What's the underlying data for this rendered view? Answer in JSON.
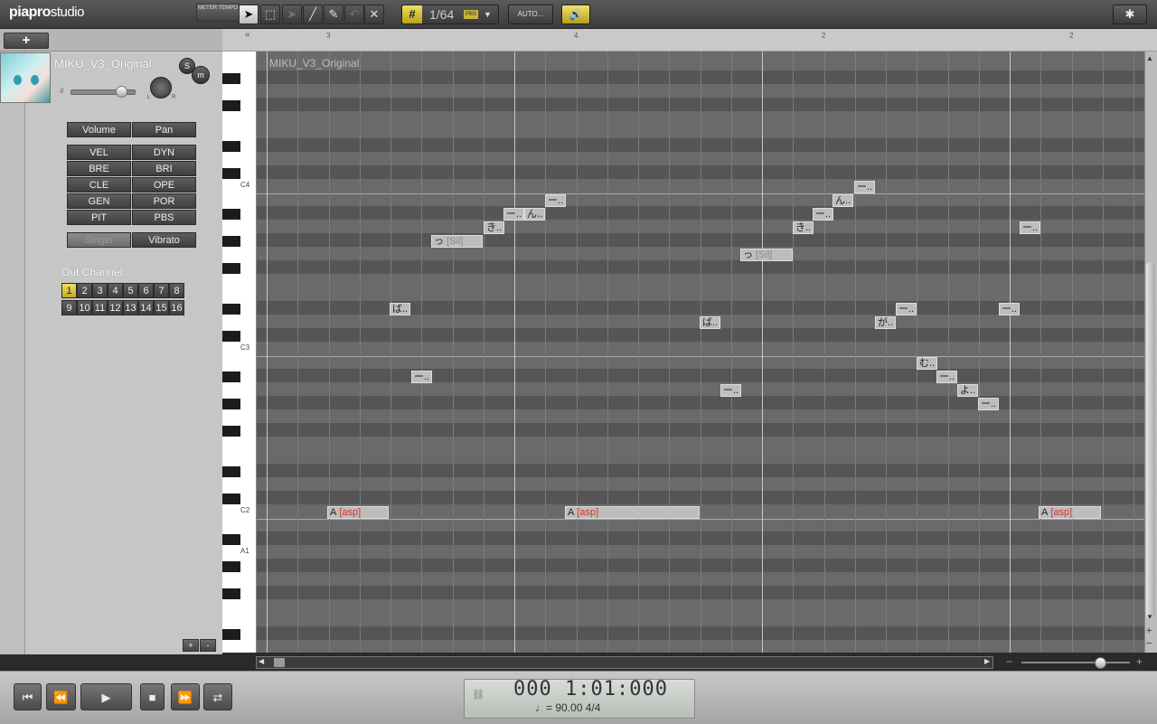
{
  "app": {
    "logo_main": "piapro",
    "logo_sub": "studio"
  },
  "toolbar": {
    "tools": [
      {
        "name": "arrow-tool",
        "glyph": "➤",
        "selected": true
      },
      {
        "name": "select-range-tool",
        "glyph": "⬚",
        "selected": false
      },
      {
        "name": "disabled-arrow-tool",
        "glyph": "➤",
        "selected": false
      },
      {
        "name": "pencil-line-tool",
        "glyph": "╱",
        "selected": false
      },
      {
        "name": "pencil-tool",
        "glyph": "✎",
        "selected": false
      },
      {
        "name": "disabled-tool",
        "glyph": "↶",
        "selected": false
      },
      {
        "name": "eraser-tool",
        "glyph": "✕",
        "selected": false
      }
    ],
    "grid_value": "1/64",
    "grid_tag": "PBS",
    "auto_label": "AUTO...",
    "speaker_glyph": "🔊",
    "settings_glyph": "✱"
  },
  "panel": {
    "add_label": "+",
    "meter_tempo": "METER TEMPO",
    "singer_name": "MIKU_V3_Original",
    "solo": "S",
    "mute": "m",
    "pan_l": "L",
    "pan_r": "R",
    "vol_icon": "ıl",
    "volume": 0.8,
    "param_rows": [
      [
        "Volume",
        "Pan"
      ],
      [
        "VEL",
        "DYN"
      ],
      [
        "BRE",
        "BRI"
      ],
      [
        "CLE",
        "OPE"
      ],
      [
        "GEN",
        "POR"
      ],
      [
        "PIT",
        "PBS"
      ],
      [
        "Singer",
        "Vibrato"
      ]
    ],
    "out_channel_label": "Out Channel:",
    "channels": [
      "1",
      "2",
      "3",
      "4",
      "5",
      "6",
      "7",
      "8",
      "9",
      "10",
      "11",
      "12",
      "13",
      "14",
      "15",
      "16"
    ],
    "selected_channel": "1",
    "plus": "+",
    "minus": "-"
  },
  "ruler": {
    "collapse": "«",
    "ticks": [
      "3",
      "4",
      "2",
      "2"
    ]
  },
  "keyboard": {
    "labels": [
      "C4",
      "C3",
      "C2",
      "A1"
    ]
  },
  "roll": {
    "track_label": "MIKU_V3_Original",
    "notes": [
      {
        "lyric": "っ",
        "phoneme": "[Sil]",
        "type": "sil"
      },
      {
        "lyric": "き..",
        "phoneme": "",
        "type": "n"
      },
      {
        "lyric": "ー..",
        "phoneme": "",
        "type": "n"
      },
      {
        "lyric": "ん..",
        "phoneme": "",
        "type": "n"
      },
      {
        "lyric": "ー..",
        "phoneme": "",
        "type": "n"
      },
      {
        "lyric": "ば..",
        "phoneme": "",
        "type": "n"
      },
      {
        "lyric": "ー..",
        "phoneme": "",
        "type": "n"
      },
      {
        "lyric": "っ",
        "phoneme": "[Sil]",
        "type": "sil"
      },
      {
        "lyric": "ば..",
        "phoneme": "",
        "type": "n"
      },
      {
        "lyric": "ー..",
        "phoneme": "",
        "type": "n"
      },
      {
        "lyric": "き..",
        "phoneme": "",
        "type": "n"
      },
      {
        "lyric": "ー..",
        "phoneme": "",
        "type": "n"
      },
      {
        "lyric": "ん..",
        "phoneme": "",
        "type": "n"
      },
      {
        "lyric": "ー..",
        "phoneme": "",
        "type": "n"
      },
      {
        "lyric": "が..",
        "phoneme": "",
        "type": "n"
      },
      {
        "lyric": "ー..",
        "phoneme": "",
        "type": "n"
      },
      {
        "lyric": "む..",
        "phoneme": "",
        "type": "n"
      },
      {
        "lyric": "ー..",
        "phoneme": "",
        "type": "n"
      },
      {
        "lyric": "よ..",
        "phoneme": "",
        "type": "n"
      },
      {
        "lyric": "ー..",
        "phoneme": "",
        "type": "n"
      },
      {
        "lyric": "ー..",
        "phoneme": "",
        "type": "n"
      },
      {
        "lyric": "ー..",
        "phoneme": "",
        "type": "n"
      },
      {
        "lyric": "A",
        "phoneme": "[asp]",
        "type": "asp"
      },
      {
        "lyric": "A",
        "phoneme": "[asp]",
        "type": "asp"
      },
      {
        "lyric": "A",
        "phoneme": "[asp]",
        "type": "asp"
      }
    ]
  },
  "scroll": {
    "up": "▲",
    "down": "▼",
    "left": "◀",
    "right": "▶",
    "zoom_plus": "+",
    "zoom_minus": "−"
  },
  "transport": {
    "buttons": [
      {
        "name": "go-to-start-button",
        "glyph": "⏮"
      },
      {
        "name": "rewind-button",
        "glyph": "⏪"
      },
      {
        "name": "play-button",
        "glyph": "▶"
      },
      {
        "name": "stop-button",
        "glyph": "■"
      },
      {
        "name": "fast-forward-button",
        "glyph": "⏩"
      },
      {
        "name": "loop-button",
        "glyph": "⇄"
      }
    ],
    "time": "000 1:01:000",
    "tempo": "♩= 90.00   4/4",
    "link_glyph": "⛓"
  }
}
